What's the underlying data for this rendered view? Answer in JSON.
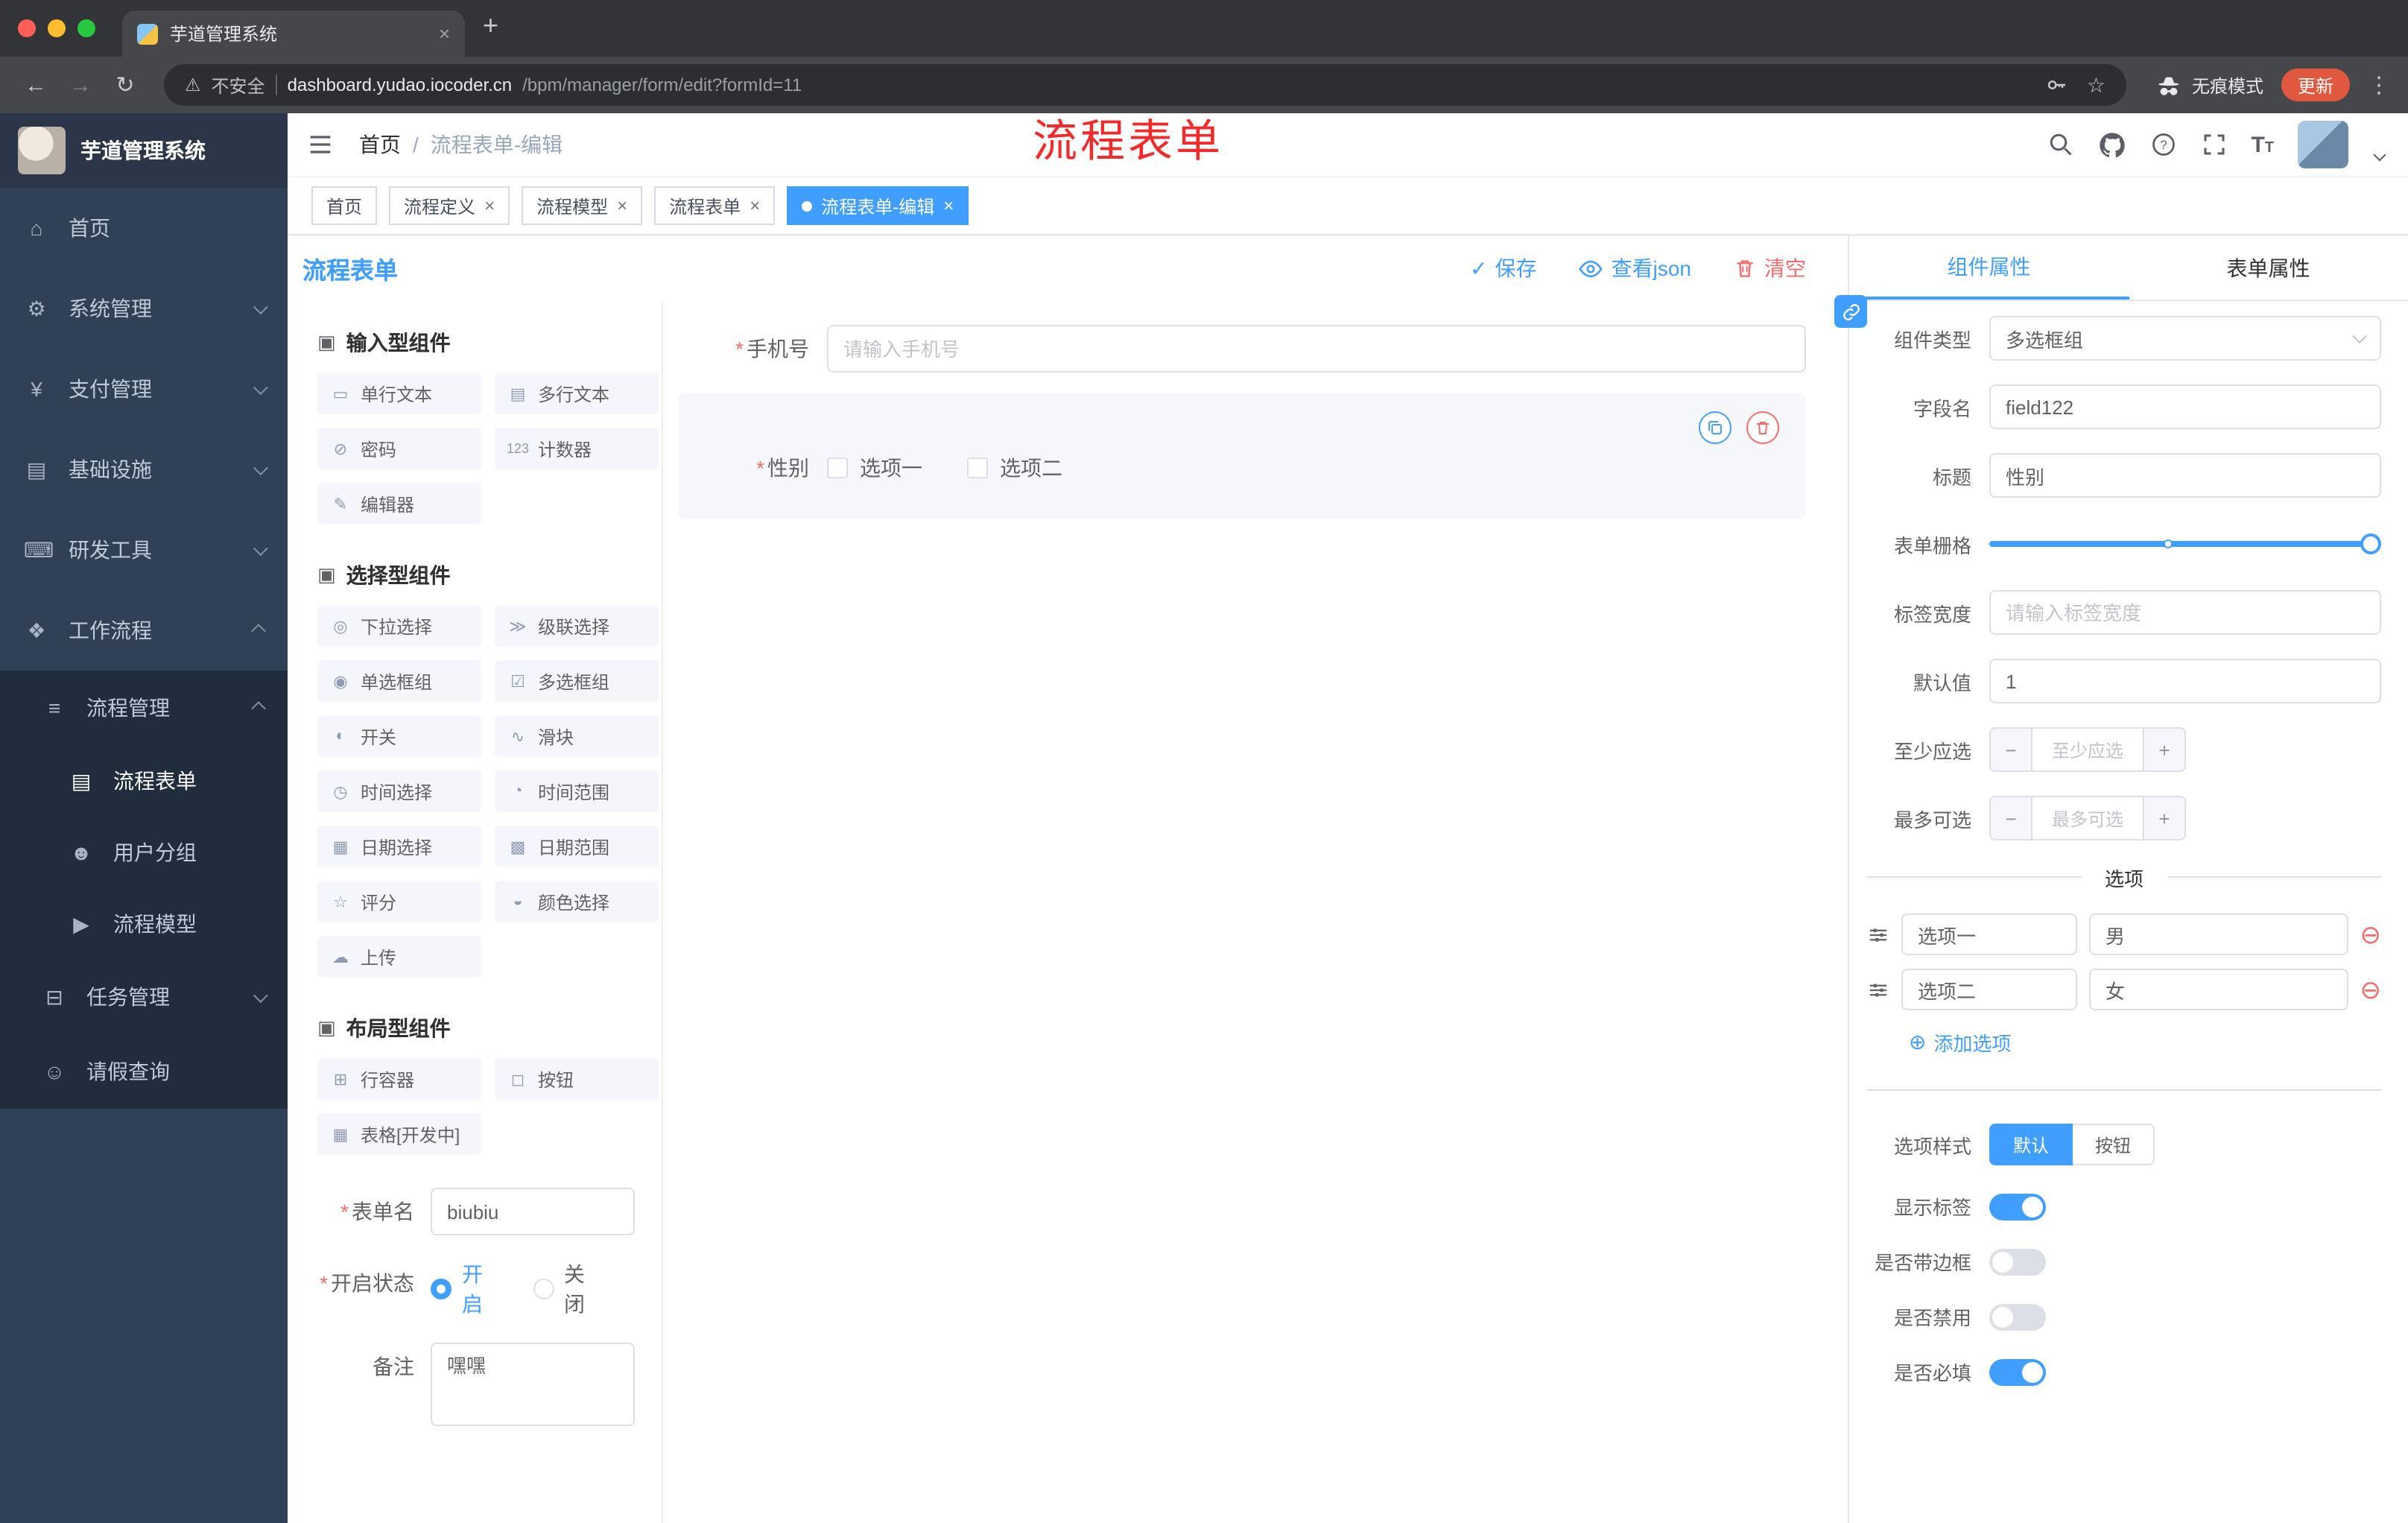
{
  "icons": {
    "close": "×",
    "check": "✓",
    "kebab": "⋮",
    "star": "☆",
    "back": "←",
    "forward": "→",
    "reload": "↻",
    "warning": "⚠",
    "minus": "−",
    "plus": "+",
    "remove": "⊖",
    "add": "⊕",
    "new_tab": "+",
    "accent_color": "#409eff",
    "danger_color": "#f56c6c"
  },
  "browser": {
    "tab_title": "芋道管理系统",
    "security_label": "不安全",
    "url_host": "dashboard.yudao.iocoder.cn",
    "url_path": "/bpm/manager/form/edit?formId=11",
    "incognito_label": "无痕模式",
    "update_label": "更新"
  },
  "annotation": {
    "text": "流程表单",
    "color": "#f42a2a"
  },
  "sidebar": {
    "logo_title": "芋道管理系统",
    "menu": [
      {
        "label": "首页",
        "icon": "⌂"
      },
      {
        "label": "系统管理",
        "icon": "⚙"
      },
      {
        "label": "支付管理",
        "icon": "¥"
      },
      {
        "label": "基础设施",
        "icon": "▤"
      },
      {
        "label": "研发工具",
        "icon": "⌨"
      },
      {
        "label": "工作流程",
        "icon": "❖"
      }
    ],
    "submenu": {
      "process_mgmt": {
        "label": "流程管理",
        "icon": "≡"
      },
      "process_form": {
        "label": "流程表单",
        "icon": "▤"
      },
      "user_group": {
        "label": "用户分组",
        "icon": "☻"
      },
      "process_model": {
        "label": "流程模型",
        "icon": "▶"
      },
      "task_mgmt": {
        "label": "任务管理",
        "icon": "⊟"
      },
      "leave_query": {
        "label": "请假查询",
        "icon": "☺"
      }
    }
  },
  "header": {
    "breadcrumb": [
      "首页",
      "流程表单-编辑"
    ]
  },
  "tags": [
    {
      "label": "首页"
    },
    {
      "label": "流程定义"
    },
    {
      "label": "流程模型"
    },
    {
      "label": "流程表单"
    },
    {
      "label": "流程表单-编辑"
    }
  ],
  "designer": {
    "title": "流程表单",
    "actions": {
      "save": "保存",
      "view_json": "查看json",
      "clear": "清空"
    }
  },
  "palette": {
    "sections": [
      {
        "title": "输入型组件",
        "icon": "▣",
        "items": [
          {
            "label": "单行文本",
            "icon": "▭"
          },
          {
            "label": "多行文本",
            "icon": "▤"
          },
          {
            "label": "密码",
            "icon": "⊘"
          },
          {
            "label": "计数器",
            "icon": "123"
          },
          {
            "label": "编辑器",
            "icon": "✎"
          }
        ]
      },
      {
        "title": "选择型组件",
        "icon": "▣",
        "items": [
          {
            "label": "下拉选择",
            "icon": "◎"
          },
          {
            "label": "级联选择",
            "icon": "≫"
          },
          {
            "label": "单选框组",
            "icon": "◉"
          },
          {
            "label": "多选框组",
            "icon": "☑"
          },
          {
            "label": "开关",
            "icon": "◐"
          },
          {
            "label": "滑块",
            "icon": "∿"
          },
          {
            "label": "时间选择",
            "icon": "◷"
          },
          {
            "label": "时间范围",
            "icon": "◔"
          },
          {
            "label": "日期选择",
            "icon": "▦"
          },
          {
            "label": "日期范围",
            "icon": "▩"
          },
          {
            "label": "评分",
            "icon": "☆"
          },
          {
            "label": "颜色选择",
            "icon": "◒"
          },
          {
            "label": "上传",
            "icon": "☁"
          }
        ]
      },
      {
        "title": "布局型组件",
        "icon": "▣",
        "items": [
          {
            "label": "行容器",
            "icon": "⊞"
          },
          {
            "label": "按钮",
            "icon": "◻"
          },
          {
            "label": "表格[开发中]",
            "icon": "▦"
          }
        ]
      }
    ]
  },
  "form_meta": {
    "name_label": "表单名",
    "name_value": "biubiu",
    "status_label": "开启状态",
    "status_options": [
      "开启",
      "关闭"
    ],
    "status_selected": "开启",
    "remark_label": "备注",
    "remark_value": "嘿嘿"
  },
  "canvas": {
    "phone": {
      "label": "手机号",
      "placeholder": "请输入手机号"
    },
    "gender": {
      "label": "性别",
      "options": [
        "选项一",
        "选项二"
      ]
    }
  },
  "props": {
    "tabs": [
      "组件属性",
      "表单属性"
    ],
    "component_type": {
      "label": "组件类型",
      "value": "多选框组"
    },
    "field_name": {
      "label": "字段名",
      "value": "field122"
    },
    "title": {
      "label": "标题",
      "value": "性别"
    },
    "grid": {
      "label": "表单栅格"
    },
    "label_width": {
      "label": "标签宽度",
      "placeholder": "请输入标签宽度"
    },
    "default_value": {
      "label": "默认值",
      "value": "1"
    },
    "min_select": {
      "label": "至少应选",
      "placeholder": "至少应选"
    },
    "max_select": {
      "label": "最多可选",
      "placeholder": "最多可选"
    },
    "options_divider": "选项",
    "options": [
      {
        "label": "选项一",
        "value": "男"
      },
      {
        "label": "选项二",
        "value": "女"
      }
    ],
    "add_option": "添加选项",
    "option_style": {
      "label": "选项样式",
      "options": [
        "默认",
        "按钮"
      ],
      "selected": "默认"
    },
    "switches": [
      {
        "label": "显示标签",
        "on": true
      },
      {
        "label": "是否带边框",
        "on": false
      },
      {
        "label": "是否禁用",
        "on": false
      },
      {
        "label": "是否必填",
        "on": true
      }
    ]
  }
}
